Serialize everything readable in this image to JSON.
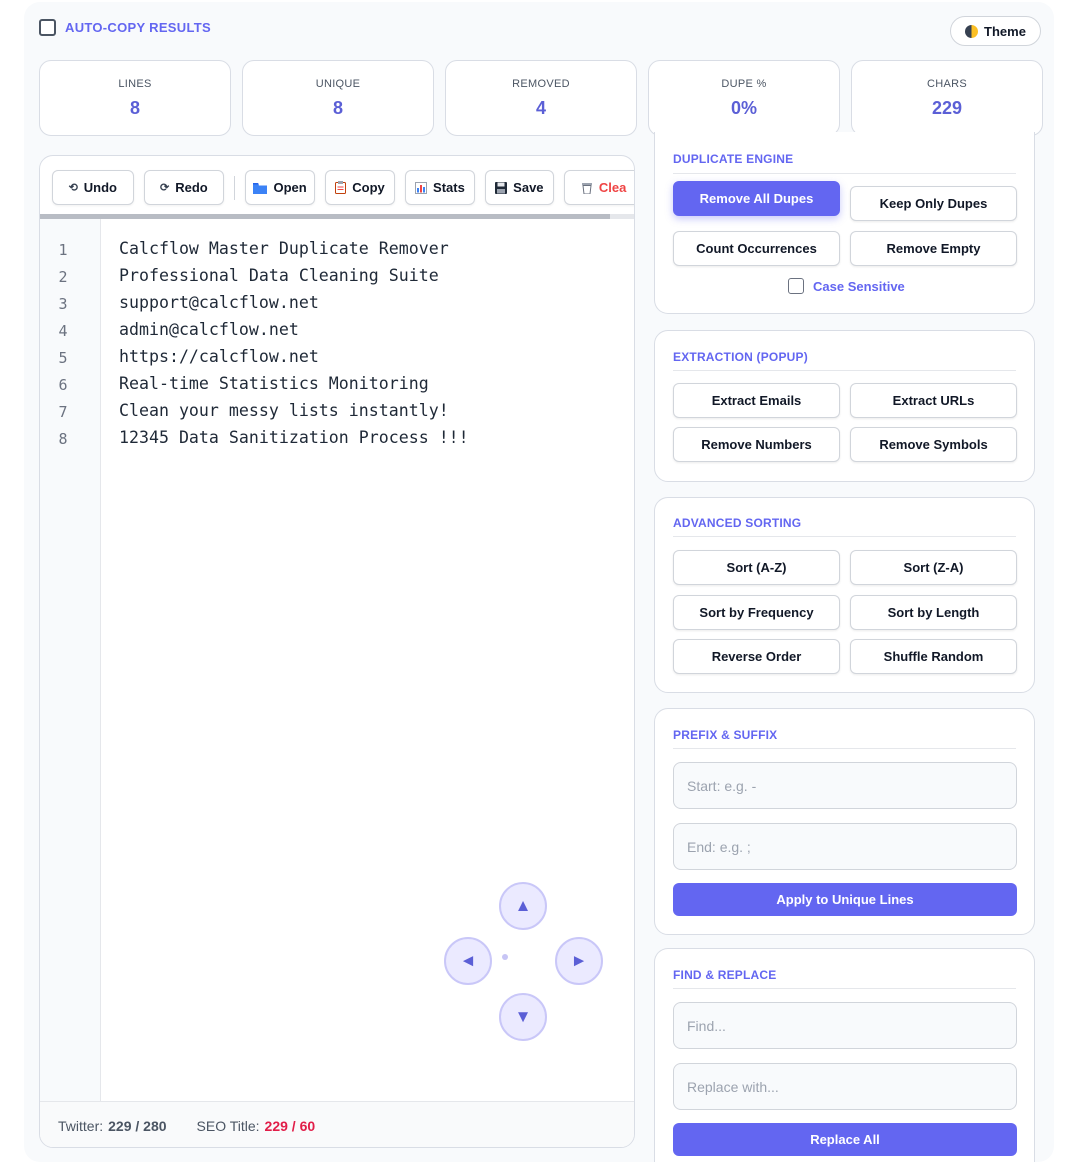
{
  "header": {
    "autocopy_label": "AUTO-COPY RESULTS",
    "theme_label": "Theme"
  },
  "stats": [
    {
      "label": "LINES",
      "value": "8"
    },
    {
      "label": "UNIQUE",
      "value": "8"
    },
    {
      "label": "REMOVED",
      "value": "4"
    },
    {
      "label": "DUPE %",
      "value": "0%"
    },
    {
      "label": "CHARS",
      "value": "229"
    }
  ],
  "toolbar": {
    "undo": "Undo",
    "redo": "Redo",
    "open": "Open",
    "copy": "Copy",
    "stats": "Stats",
    "save": "Save",
    "clear": "Clea"
  },
  "editor": {
    "line_numbers": [
      "1",
      "2",
      "3",
      "4",
      "5",
      "6",
      "7",
      "8"
    ],
    "lines": [
      "Calcflow Master Duplicate Remover",
      "Professional Data Cleaning Suite",
      "support@calcflow.net",
      "admin@calcflow.net",
      "https://calcflow.net",
      "Real-time Statistics Monitoring",
      "Clean your messy lists instantly!",
      "12345 Data Sanitization Process !!!"
    ]
  },
  "dpad": {
    "up": "▲",
    "down": "▼",
    "left": "◄",
    "right": "►"
  },
  "footer": {
    "twitter_label": "Twitter:",
    "twitter_value": "229 / 280",
    "seo_label": "SEO Title:",
    "seo_value": "229 / 60"
  },
  "duplicate_engine": {
    "title": "DUPLICATE ENGINE",
    "remove_all": "Remove All Dupes",
    "keep_only": "Keep Only Dupes",
    "count": "Count Occurrences",
    "remove_empty": "Remove Empty",
    "case_sensitive": "Case Sensitive"
  },
  "extraction": {
    "title": "EXTRACTION (POPUP)",
    "emails": "Extract Emails",
    "urls": "Extract URLs",
    "numbers": "Remove Numbers",
    "symbols": "Remove Symbols"
  },
  "sorting": {
    "title": "ADVANCED SORTING",
    "az": "Sort (A-Z)",
    "za": "Sort (Z-A)",
    "frequency": "Sort by Frequency",
    "length": "Sort by Length",
    "reverse": "Reverse Order",
    "shuffle": "Shuffle Random"
  },
  "prefix_suffix": {
    "title": "PREFIX & SUFFIX",
    "start_placeholder": "Start: e.g. -",
    "end_placeholder": "End: e.g. ;",
    "apply": "Apply to Unique Lines"
  },
  "find_replace": {
    "title": "FIND & REPLACE",
    "find_placeholder": "Find...",
    "replace_placeholder": "Replace with...",
    "replace_all": "Replace All"
  },
  "colors": {
    "accent": "#6366f1",
    "stat_value": "#5b5fd6",
    "danger": "#ef4444"
  }
}
